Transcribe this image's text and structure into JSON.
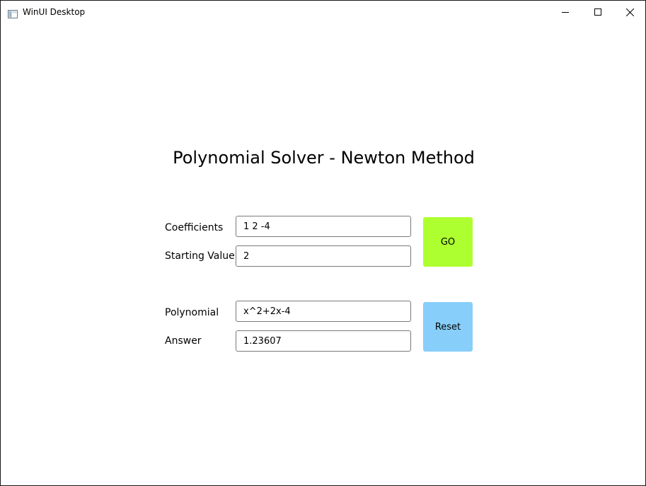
{
  "window": {
    "title": "WinUI Desktop",
    "icon": "app-window-icon",
    "controls": {
      "minimize_icon": "minimize-icon",
      "maximize_icon": "maximize-icon",
      "close_icon": "close-icon"
    }
  },
  "main": {
    "title": "Polynomial Solver - Newton Method",
    "inputs": {
      "coefficients_label": "Coefficients",
      "coefficients_value": "1 2 -4",
      "starting_value_label": "Starting Value",
      "starting_value_value": "2",
      "go_label": "GO",
      "go_color": "#adff2f"
    },
    "outputs": {
      "polynomial_label": "Polynomial",
      "polynomial_value": "x^2+2x-4",
      "answer_label": "Answer",
      "answer_value": "1.23607",
      "reset_label": "Reset",
      "reset_color": "#87cefa"
    }
  }
}
